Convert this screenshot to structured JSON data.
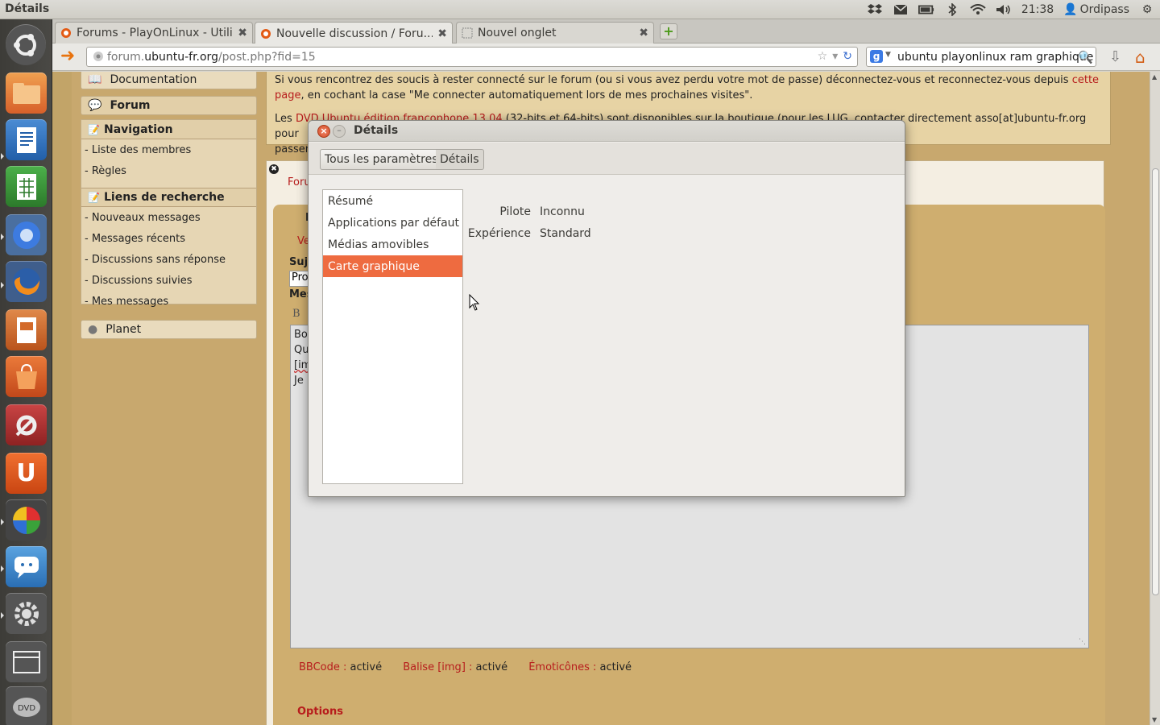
{
  "top_panel": {
    "app_title": "Détails",
    "clock": "21:38",
    "user": "Ordipass",
    "indicator_icons": [
      "dropbox-icon",
      "mail-icon",
      "battery-icon",
      "bluetooth-icon",
      "wifi-icon",
      "volume-icon"
    ]
  },
  "launcher": {
    "items": [
      "ubuntu-dash-icon",
      "files-icon",
      "writer-icon",
      "calc-icon",
      "chromium-icon",
      "firefox-icon",
      "impress-icon",
      "software-center-icon",
      "settings-tools-icon",
      "ubuntu-one-icon",
      "playonlinux-icon",
      "empathy-icon",
      "system-settings-icon",
      "workspace-icon",
      "dvd-icon"
    ]
  },
  "browser": {
    "tabs": [
      {
        "label": "Forums - PlayOnLinux - Utili...",
        "active": false
      },
      {
        "label": "Nouvelle discussion / Foru...",
        "active": true
      },
      {
        "label": "Nouvel onglet",
        "active": false
      }
    ],
    "url_prefix": "forum.",
    "url_host": "ubuntu-fr.org",
    "url_path": "/post.php?fid=15",
    "search_value": "ubuntu playonlinux ram graphique"
  },
  "page": {
    "sidebar": {
      "documentation": "Documentation",
      "forum": "Forum",
      "navigation_title": "Navigation",
      "navigation_links": [
        "- Liste des membres",
        "- Règles"
      ],
      "search_title": "Liens de recherche",
      "search_links": [
        "- Nouveaux messages",
        "- Messages récents",
        "- Discussions sans réponse",
        "- Discussions suivies",
        "- Mes messages"
      ],
      "planet": "Planet"
    },
    "notice": {
      "line1_a": "Si vous rencontrez des soucis à rester connecté sur le forum (ou si vous avez perdu votre mot de passe) déconnectez-vous et reconnectez-vous depuis",
      "line1_link": "cette",
      "line2_link": "page",
      "line2_b": ", en cochant la case \"Me connecter automatiquement lors de mes prochaines visites\".",
      "line3_a": "Les",
      "line3_link": "DVD Ubuntu édition francophone 13.04",
      "line3_b": "(32-bits et 64-bits) sont disponibles sur la boutique (pour les LUG, contacter directement asso[at]ubuntu-fr.org pour",
      "line4": "passer"
    },
    "post": {
      "crumb": "Foru",
      "heading_frag": "N",
      "ve_frag": "Ve",
      "subject_label": "Suje",
      "subject_value": "Pro",
      "message_label": "Mes",
      "bold_btn": "B",
      "message_lines": [
        "Bo",
        "Qu",
        "[im",
        "Je"
      ],
      "bbcode_key": "BBCode :",
      "bbcode_val": "activé",
      "img_key": "Balise [img] :",
      "img_val": "activé",
      "emot_key": "Émoticônes :",
      "emot_val": "activé",
      "options": "Options"
    }
  },
  "dialog": {
    "title": "Détails",
    "breadcrumb": [
      "Tous les paramètres",
      "Détails"
    ],
    "list": [
      {
        "label": "Résumé",
        "selected": false
      },
      {
        "label": "Applications par défaut",
        "selected": false
      },
      {
        "label": "Médias amovibles",
        "selected": false
      },
      {
        "label": "Carte graphique",
        "selected": true
      }
    ],
    "fields": [
      {
        "label": "Pilote",
        "value": "Inconnu"
      },
      {
        "label": "Expérience",
        "value": "Standard"
      }
    ]
  },
  "colors": {
    "accent_orange": "#ee6b40",
    "page_tan": "#c8a86e",
    "link_red": "#b71c1c"
  }
}
